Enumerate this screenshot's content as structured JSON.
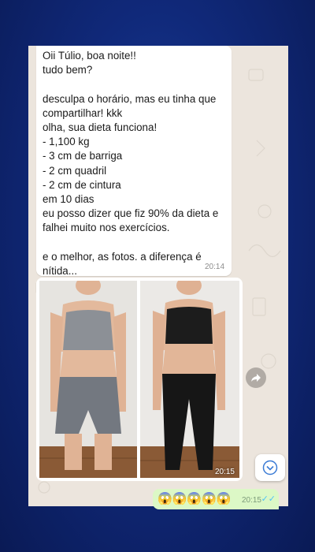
{
  "chat": {
    "message_lines": [
      "Oii Túlio, boa noite!!",
      "tudo bem?",
      "",
      "desculpa o horário, mas eu tinha que",
      "compartilhar! kkk",
      "olha, sua dieta funciona!",
      "- 1,100 kg",
      "- 3 cm de barriga",
      "- 2 cm quadril",
      "- 2 cm de cintura",
      "em 10 dias",
      "eu posso dizer que fiz 90% da dieta e",
      "falhei muito nos exercícios.",
      "",
      "e o melhor, as fotos. a diferença é",
      "nítida..."
    ],
    "message_time": "20:14",
    "photo_time": "20:15",
    "outgoing_emojis": "😱😱😱😱😱",
    "outgoing_time": "20:15",
    "read_ticks": "✓✓"
  },
  "icons": {
    "forward": "forward-arrow-icon",
    "scroll": "chevron-down-icon"
  },
  "colors": {
    "chat_background": "#ece5dd",
    "incoming_bubble": "#ffffff",
    "outgoing_bubble": "#dcf8c6",
    "page_background": "#10297a",
    "tick_blue": "#4fc3f7"
  }
}
